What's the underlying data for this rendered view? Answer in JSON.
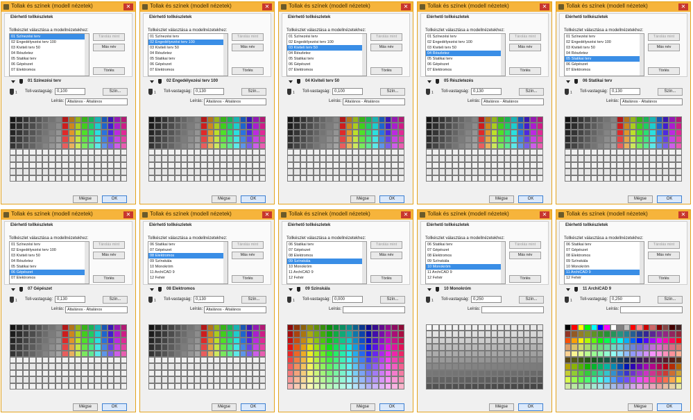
{
  "dialogs": [
    {
      "title": "Tollak és színek (modell nézetek)",
      "heading": "Elérhető tollkészletek",
      "subheading": "Tollkészlet választása a modellnézetekhez:",
      "items": [
        "01 Színezési terv",
        "02 Engedélyezési terv 100",
        "03 Kiviteli terv 50",
        "04 Részletez",
        "05 Statikai terv",
        "06 Gépészet",
        "07 Elektromos"
      ],
      "selected": 0,
      "buttons": [
        "Tárolás mint",
        "Más név",
        "Törlés"
      ],
      "section": "01 Színezési terv",
      "pen_no": "1",
      "thickness_label": "Toll-vastagság:",
      "thickness": "0,100",
      "color_button": "Szín...",
      "desc_label": "Leírás:",
      "description": "Általános - Általános",
      "cancel": "Mégse",
      "ok": "OK"
    },
    {
      "title": "Tollak és színek (modell nézetek)",
      "heading": "Elérhető tollkészletek",
      "subheading": "Tollkészlet választása a modellnézetekhez:",
      "items": [
        "01 Színezési terv",
        "02 Engedélyezési terv 100",
        "03 Kiviteli terv 50",
        "04 Részletez",
        "05 Statikai terv",
        "06 Gépészet",
        "07 Elektromos"
      ],
      "selected": 1,
      "buttons": [
        "Tárolás mint",
        "Más név",
        "Törlés"
      ],
      "section": "02 Engedélyezési terv 100",
      "pen_no": "1",
      "thickness_label": "Toll-vastagság:",
      "thickness": "0,130",
      "color_button": "Szín...",
      "desc_label": "Leírás:",
      "description": "Általános - Általános",
      "cancel": "Mégse",
      "ok": "OK"
    },
    {
      "title": "Tollak és színek (modell nézetek)",
      "heading": "Elérhető tollkészletek",
      "subheading": "Tollkészlet választása a modellnézetekhez:",
      "items": [
        "01 Színezési terv",
        "02 Engedélyezési terv 100",
        "03 Kiviteli terv 50",
        "04 Részletez",
        "05 Statikai terv",
        "06 Gépészet",
        "07 Elektromos"
      ],
      "selected": 2,
      "buttons": [
        "Tárolás mint",
        "Más név",
        "Törlés"
      ],
      "section": "04 Kiviteli terv 50",
      "pen_no": "1",
      "thickness_label": "Toll-vastagság:",
      "thickness": "0,100",
      "color_button": "Szín...",
      "desc_label": "Leírás:",
      "description": "Általános - Általános",
      "cancel": "Mégse",
      "ok": "OK"
    },
    {
      "title": "Tollak és színek (modell nézetek)",
      "heading": "Elérhető tollkészletek",
      "subheading": "Tollkészlet választása a modellnézetekhez:",
      "items": [
        "01 Színezési terv",
        "02 Engedélyezési terv 100",
        "03 Kiviteli terv 50",
        "04 Részletez",
        "05 Statikai terv",
        "06 Gépészet",
        "07 Elektromos"
      ],
      "selected": 3,
      "buttons": [
        "Tárolás mint",
        "Más név",
        "Törlés"
      ],
      "section": "05 Részletezés",
      "pen_no": "1",
      "thickness_label": "Toll-vastagság:",
      "thickness": "0,130",
      "color_button": "Szín...",
      "desc_label": "Leírás:",
      "description": "Általános - Általános",
      "cancel": "Mégse",
      "ok": "OK"
    },
    {
      "title": "Tollak és színek (modell nézetek)",
      "heading": "Elérhető tollkészletek",
      "subheading": "Tollkészlet választása a modellnézetekhez:",
      "items": [
        "01 Színezési terv",
        "02 Engedélyezési terv 100",
        "03 Kiviteli terv 50",
        "04 Részletez",
        "05 Statikai terv",
        "06 Gépészet",
        "07 Elektromos"
      ],
      "selected": 4,
      "buttons": [
        "Tárolás mint",
        "Más név",
        "Törlés"
      ],
      "section": "06 Statikai terv",
      "pen_no": "1",
      "thickness_label": "Toll-vastagság:",
      "thickness": "0,130",
      "color_button": "Szín...",
      "desc_label": "Leírás:",
      "description": "Általános - Általános",
      "cancel": "Mégse",
      "ok": "OK"
    },
    {
      "title": "Tollak és színek (modell nézetek)",
      "heading": "Elérhető tollkészletek",
      "subheading": "Tollkészlet választása a modellnézetekhez:",
      "items": [
        "01 Színezési terv",
        "02 Engedélyezési terv 100",
        "03 Kiviteli terv 50",
        "04 Részletez",
        "05 Statikai terv",
        "06 Gépészet",
        "07 Elektromos"
      ],
      "selected": 5,
      "buttons": [
        "Tárolás mint",
        "Más név",
        "Törlés"
      ],
      "section": "07 Gépészet",
      "pen_no": "1",
      "thickness_label": "Toll-vastagság:",
      "thickness": "0,130",
      "color_button": "Szín...",
      "desc_label": "Leírás:",
      "description": "Általános - Általános",
      "cancel": "Mégse",
      "ok": "OK"
    },
    {
      "title": "Tollak és színek (modell nézetek)",
      "heading": "Elérhető tollkészletek",
      "subheading": "Tollkészlet választása a modellnézetekhez:",
      "items": [
        "06 Statikai terv",
        "07 Gépészet",
        "08 Elektromos",
        "09 Színskála",
        "10 Monokróm",
        "11 ArchiCAD 9",
        "12 Fehér"
      ],
      "selected": 2,
      "buttons": [
        "Tárolás mint",
        "Más név",
        "Törlés"
      ],
      "section": "08 Elektromos",
      "pen_no": "1",
      "thickness_label": "Toll-vastagság:",
      "thickness": "0,130",
      "color_button": "Szín...",
      "desc_label": "Leírás:",
      "description": "Általános - Általános",
      "cancel": "Mégse",
      "ok": "OK"
    },
    {
      "title": "Tollak és színek (modell nézetek)",
      "heading": "Elérhető tollkészletek",
      "subheading": "Tollkészlet választása a modellnézetekhez:",
      "items": [
        "06 Statikai terv",
        "07 Gépészet",
        "08 Elektromos",
        "09 Színskála",
        "10 Monokróm",
        "11 ArchiCAD 9",
        "12 Fehér"
      ],
      "selected": 3,
      "buttons": [
        "Tárolás mint",
        "Más név",
        "Törlés"
      ],
      "section": "09 Színskála",
      "pen_no": "1",
      "thickness_label": "Toll-vastagság:",
      "thickness": "0,000",
      "color_button": "Szín...",
      "desc_label": "Leírás:",
      "description": "",
      "cancel": "Mégse",
      "ok": "OK"
    },
    {
      "title": "Tollak és színek (modell nézetek)",
      "heading": "Elérhető tollkészletek",
      "subheading": "Tollkészlet választása a modellnézetekhez:",
      "items": [
        "06 Statikai terv",
        "07 Gépészet",
        "08 Elektromos",
        "09 Színskála",
        "10 Monokróm",
        "11 ArchiCAD 9",
        "12 Fehér"
      ],
      "selected": 4,
      "buttons": [
        "Tárolás mint",
        "Más név",
        "Törlés"
      ],
      "section": "10 Monokróm",
      "pen_no": "1",
      "thickness_label": "Toll-vastagság:",
      "thickness": "0,250",
      "color_button": "Szín...",
      "desc_label": "Leírás:",
      "description": "",
      "cancel": "Mégse",
      "ok": "OK"
    },
    {
      "title": "Tollak és színek (modell nézetek)",
      "heading": "Elérhető tollkészletek",
      "subheading": "Tollkészlet választása a modellnézetekhez:",
      "items": [
        "06 Statikai terv",
        "07 Gépészet",
        "08 Elektromos",
        "09 Színskála",
        "10 Monokróm",
        "11 ArchiCAD 9",
        "12 Fehér"
      ],
      "selected": 5,
      "buttons": [
        "Tárolás mint",
        "Más név",
        "Törlés"
      ],
      "section": "11 ArchiCAD 9",
      "pen_no": "1",
      "thickness_label": "Toll-vastagság:",
      "thickness": "0,250",
      "color_button": "Szín...",
      "desc_label": "Leírás:",
      "description": "",
      "cancel": "Mégse",
      "ok": "OK"
    }
  ],
  "palette_types": [
    "std",
    "std",
    "std",
    "std",
    "std",
    "std",
    "std",
    "spectrum",
    "mono",
    "acad"
  ],
  "colors": {
    "titlebar": "#f6b43b",
    "selection": "#3a8ee6",
    "border": "#e3a21a"
  }
}
